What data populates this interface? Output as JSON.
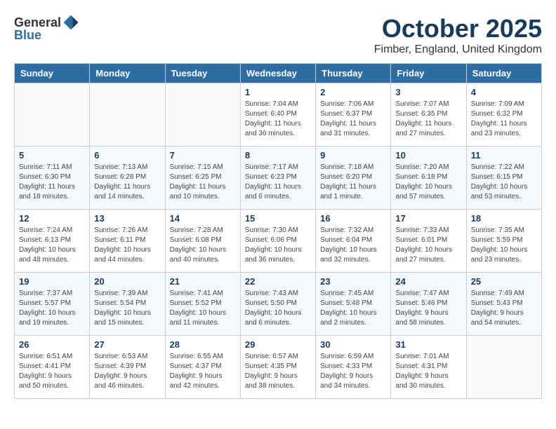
{
  "logo": {
    "general": "General",
    "blue": "Blue"
  },
  "title": "October 2025",
  "location": "Fimber, England, United Kingdom",
  "days_of_week": [
    "Sunday",
    "Monday",
    "Tuesday",
    "Wednesday",
    "Thursday",
    "Friday",
    "Saturday"
  ],
  "weeks": [
    [
      {
        "day": "",
        "info": ""
      },
      {
        "day": "",
        "info": ""
      },
      {
        "day": "",
        "info": ""
      },
      {
        "day": "1",
        "info": "Sunrise: 7:04 AM\nSunset: 6:40 PM\nDaylight: 11 hours\nand 36 minutes."
      },
      {
        "day": "2",
        "info": "Sunrise: 7:06 AM\nSunset: 6:37 PM\nDaylight: 11 hours\nand 31 minutes."
      },
      {
        "day": "3",
        "info": "Sunrise: 7:07 AM\nSunset: 6:35 PM\nDaylight: 11 hours\nand 27 minutes."
      },
      {
        "day": "4",
        "info": "Sunrise: 7:09 AM\nSunset: 6:32 PM\nDaylight: 11 hours\nand 23 minutes."
      }
    ],
    [
      {
        "day": "5",
        "info": "Sunrise: 7:11 AM\nSunset: 6:30 PM\nDaylight: 11 hours\nand 18 minutes."
      },
      {
        "day": "6",
        "info": "Sunrise: 7:13 AM\nSunset: 6:28 PM\nDaylight: 11 hours\nand 14 minutes."
      },
      {
        "day": "7",
        "info": "Sunrise: 7:15 AM\nSunset: 6:25 PM\nDaylight: 11 hours\nand 10 minutes."
      },
      {
        "day": "8",
        "info": "Sunrise: 7:17 AM\nSunset: 6:23 PM\nDaylight: 11 hours\nand 6 minutes."
      },
      {
        "day": "9",
        "info": "Sunrise: 7:18 AM\nSunset: 6:20 PM\nDaylight: 11 hours\nand 1 minute."
      },
      {
        "day": "10",
        "info": "Sunrise: 7:20 AM\nSunset: 6:18 PM\nDaylight: 10 hours\nand 57 minutes."
      },
      {
        "day": "11",
        "info": "Sunrise: 7:22 AM\nSunset: 6:15 PM\nDaylight: 10 hours\nand 53 minutes."
      }
    ],
    [
      {
        "day": "12",
        "info": "Sunrise: 7:24 AM\nSunset: 6:13 PM\nDaylight: 10 hours\nand 48 minutes."
      },
      {
        "day": "13",
        "info": "Sunrise: 7:26 AM\nSunset: 6:11 PM\nDaylight: 10 hours\nand 44 minutes."
      },
      {
        "day": "14",
        "info": "Sunrise: 7:28 AM\nSunset: 6:08 PM\nDaylight: 10 hours\nand 40 minutes."
      },
      {
        "day": "15",
        "info": "Sunrise: 7:30 AM\nSunset: 6:06 PM\nDaylight: 10 hours\nand 36 minutes."
      },
      {
        "day": "16",
        "info": "Sunrise: 7:32 AM\nSunset: 6:04 PM\nDaylight: 10 hours\nand 32 minutes."
      },
      {
        "day": "17",
        "info": "Sunrise: 7:33 AM\nSunset: 6:01 PM\nDaylight: 10 hours\nand 27 minutes."
      },
      {
        "day": "18",
        "info": "Sunrise: 7:35 AM\nSunset: 5:59 PM\nDaylight: 10 hours\nand 23 minutes."
      }
    ],
    [
      {
        "day": "19",
        "info": "Sunrise: 7:37 AM\nSunset: 5:57 PM\nDaylight: 10 hours\nand 19 minutes."
      },
      {
        "day": "20",
        "info": "Sunrise: 7:39 AM\nSunset: 5:54 PM\nDaylight: 10 hours\nand 15 minutes."
      },
      {
        "day": "21",
        "info": "Sunrise: 7:41 AM\nSunset: 5:52 PM\nDaylight: 10 hours\nand 11 minutes."
      },
      {
        "day": "22",
        "info": "Sunrise: 7:43 AM\nSunset: 5:50 PM\nDaylight: 10 hours\nand 6 minutes."
      },
      {
        "day": "23",
        "info": "Sunrise: 7:45 AM\nSunset: 5:48 PM\nDaylight: 10 hours\nand 2 minutes."
      },
      {
        "day": "24",
        "info": "Sunrise: 7:47 AM\nSunset: 5:46 PM\nDaylight: 9 hours\nand 58 minutes."
      },
      {
        "day": "25",
        "info": "Sunrise: 7:49 AM\nSunset: 5:43 PM\nDaylight: 9 hours\nand 54 minutes."
      }
    ],
    [
      {
        "day": "26",
        "info": "Sunrise: 6:51 AM\nSunset: 4:41 PM\nDaylight: 9 hours\nand 50 minutes."
      },
      {
        "day": "27",
        "info": "Sunrise: 6:53 AM\nSunset: 4:39 PM\nDaylight: 9 hours\nand 46 minutes."
      },
      {
        "day": "28",
        "info": "Sunrise: 6:55 AM\nSunset: 4:37 PM\nDaylight: 9 hours\nand 42 minutes."
      },
      {
        "day": "29",
        "info": "Sunrise: 6:57 AM\nSunset: 4:35 PM\nDaylight: 9 hours\nand 38 minutes."
      },
      {
        "day": "30",
        "info": "Sunrise: 6:59 AM\nSunset: 4:33 PM\nDaylight: 9 hours\nand 34 minutes."
      },
      {
        "day": "31",
        "info": "Sunrise: 7:01 AM\nSunset: 4:31 PM\nDaylight: 9 hours\nand 30 minutes."
      },
      {
        "day": "",
        "info": ""
      }
    ]
  ]
}
